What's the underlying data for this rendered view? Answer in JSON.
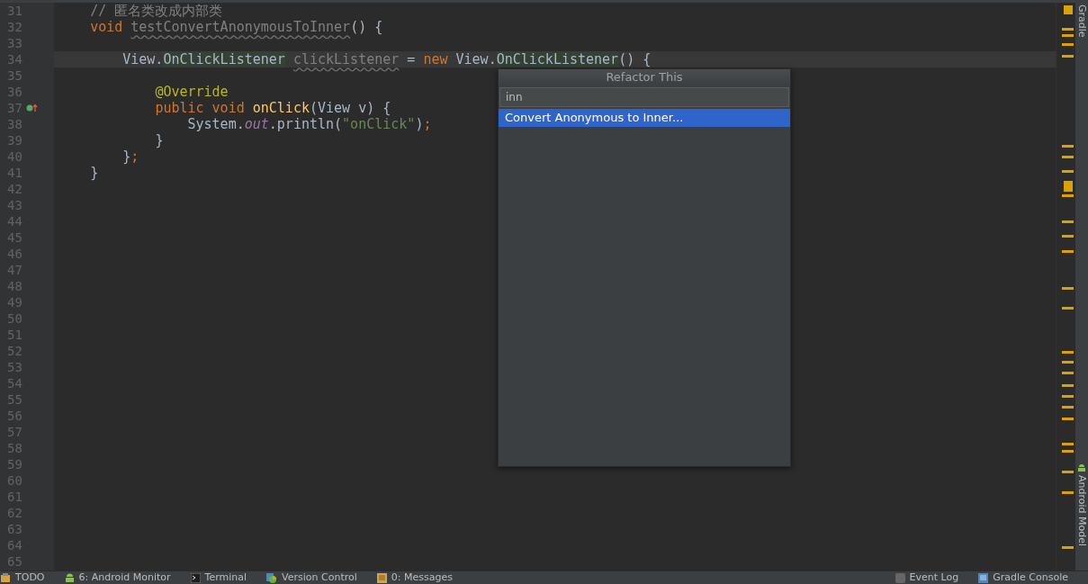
{
  "editor": {
    "lines": [
      {
        "number": "31",
        "current": false,
        "gutter_icon": false,
        "tokens": [
          {
            "text": "    // 匿名类改成内部类",
            "kind": "comment"
          }
        ]
      },
      {
        "number": "32",
        "current": false,
        "gutter_icon": false,
        "tokens": [
          {
            "text": "    void ",
            "kind": "keyword"
          },
          {
            "text": "testConvertAnonymousToInner",
            "kind": "unused"
          },
          {
            "text": "() {",
            "kind": "plain"
          }
        ]
      },
      {
        "number": "33",
        "current": false,
        "gutter_icon": false
      },
      {
        "number": "34",
        "current": true,
        "gutter_icon": false,
        "tokens": [
          {
            "text": "        View.",
            "kind": "plain"
          },
          {
            "text": "OnClickListener",
            "kind": "highlight"
          },
          {
            "text": " clickListener",
            "kind": "unused"
          },
          {
            "text": " = ",
            "kind": "plain"
          },
          {
            "text": "new",
            "kind": "keyword"
          },
          {
            "text": " View.",
            "kind": "plain"
          },
          {
            "text": "OnClickListener",
            "kind": "highlight"
          },
          {
            "text": "() {",
            "kind": "plain"
          }
        ]
      },
      {
        "number": "35",
        "current": false,
        "gutter_icon": false
      },
      {
        "number": "36",
        "current": false,
        "gutter_icon": false,
        "tokens": [
          {
            "text": "            @Override",
            "kind": "annotation"
          }
        ]
      },
      {
        "number": "37",
        "current": false,
        "gutter_icon": true,
        "tokens": [
          {
            "text": "            public void ",
            "kind": "keyword"
          },
          {
            "text": "onClick",
            "kind": "method"
          },
          {
            "text": "(View v) {",
            "kind": "plain"
          }
        ]
      },
      {
        "number": "38",
        "current": false,
        "gutter_icon": false,
        "tokens": [
          {
            "text": "                System.",
            "kind": "plain"
          },
          {
            "text": "out",
            "kind": "field"
          },
          {
            "text": ".println(",
            "kind": "plain"
          },
          {
            "text": "\"onClick\"",
            "kind": "string"
          },
          {
            "text": ")",
            "kind": "plain"
          },
          {
            "text": ";",
            "kind": "keyword"
          }
        ]
      },
      {
        "number": "39",
        "current": false,
        "gutter_icon": false,
        "tokens": [
          {
            "text": "            }",
            "kind": "plain"
          }
        ]
      },
      {
        "number": "40",
        "current": false,
        "gutter_icon": false,
        "tokens": [
          {
            "text": "        }",
            "kind": "plain"
          },
          {
            "text": ";",
            "kind": "keyword"
          }
        ]
      },
      {
        "number": "41",
        "current": false,
        "gutter_icon": false,
        "tokens": [
          {
            "text": "    }",
            "kind": "plain"
          }
        ]
      },
      {
        "number": "42",
        "current": false,
        "gutter_icon": false
      },
      {
        "number": "43",
        "current": false,
        "gutter_icon": false
      },
      {
        "number": "44",
        "current": false,
        "gutter_icon": false
      },
      {
        "number": "45",
        "current": false,
        "gutter_icon": false
      },
      {
        "number": "46",
        "current": false,
        "gutter_icon": false
      },
      {
        "number": "47",
        "current": false,
        "gutter_icon": false
      },
      {
        "number": "48",
        "current": false,
        "gutter_icon": false
      },
      {
        "number": "49",
        "current": false,
        "gutter_icon": false
      },
      {
        "number": "50",
        "current": false,
        "gutter_icon": false
      },
      {
        "number": "51",
        "current": false,
        "gutter_icon": false
      },
      {
        "number": "52",
        "current": false,
        "gutter_icon": false
      },
      {
        "number": "53",
        "current": false,
        "gutter_icon": false
      },
      {
        "number": "54",
        "current": false,
        "gutter_icon": false
      },
      {
        "number": "55",
        "current": false,
        "gutter_icon": false
      },
      {
        "number": "56",
        "current": false,
        "gutter_icon": false
      },
      {
        "number": "57",
        "current": false,
        "gutter_icon": false
      },
      {
        "number": "58",
        "current": false,
        "gutter_icon": false
      },
      {
        "number": "59",
        "current": false,
        "gutter_icon": false
      },
      {
        "number": "60",
        "current": false,
        "gutter_icon": false
      },
      {
        "number": "61",
        "current": false,
        "gutter_icon": false
      },
      {
        "number": "62",
        "current": false,
        "gutter_icon": false
      },
      {
        "number": "63",
        "current": false,
        "gutter_icon": false
      },
      {
        "number": "64",
        "current": false,
        "gutter_icon": false
      },
      {
        "number": "65",
        "current": false,
        "gutter_icon": false
      }
    ]
  },
  "popup": {
    "title": "Refactor This",
    "search": {
      "value": "inn"
    },
    "items": [
      {
        "label": "Convert Anonymous to Inner...",
        "selected": true
      }
    ]
  },
  "side_tabs": [
    {
      "label": "Gradle",
      "kind": "gradle"
    },
    {
      "label": "Android Model",
      "kind": "android"
    }
  ],
  "bottom_bar": {
    "left": [
      {
        "label": "TODO",
        "kind": "todo"
      },
      {
        "label": "6: Android Monitor",
        "kind": "android"
      },
      {
        "label": "Terminal",
        "kind": "terminal"
      },
      {
        "label": "Version Control",
        "kind": "vcs"
      },
      {
        "label": "0: Messages",
        "kind": "messages"
      }
    ],
    "right": [
      {
        "label": "Event Log",
        "kind": "eventlog"
      },
      {
        "label": "Gradle Console",
        "kind": "console"
      }
    ]
  }
}
